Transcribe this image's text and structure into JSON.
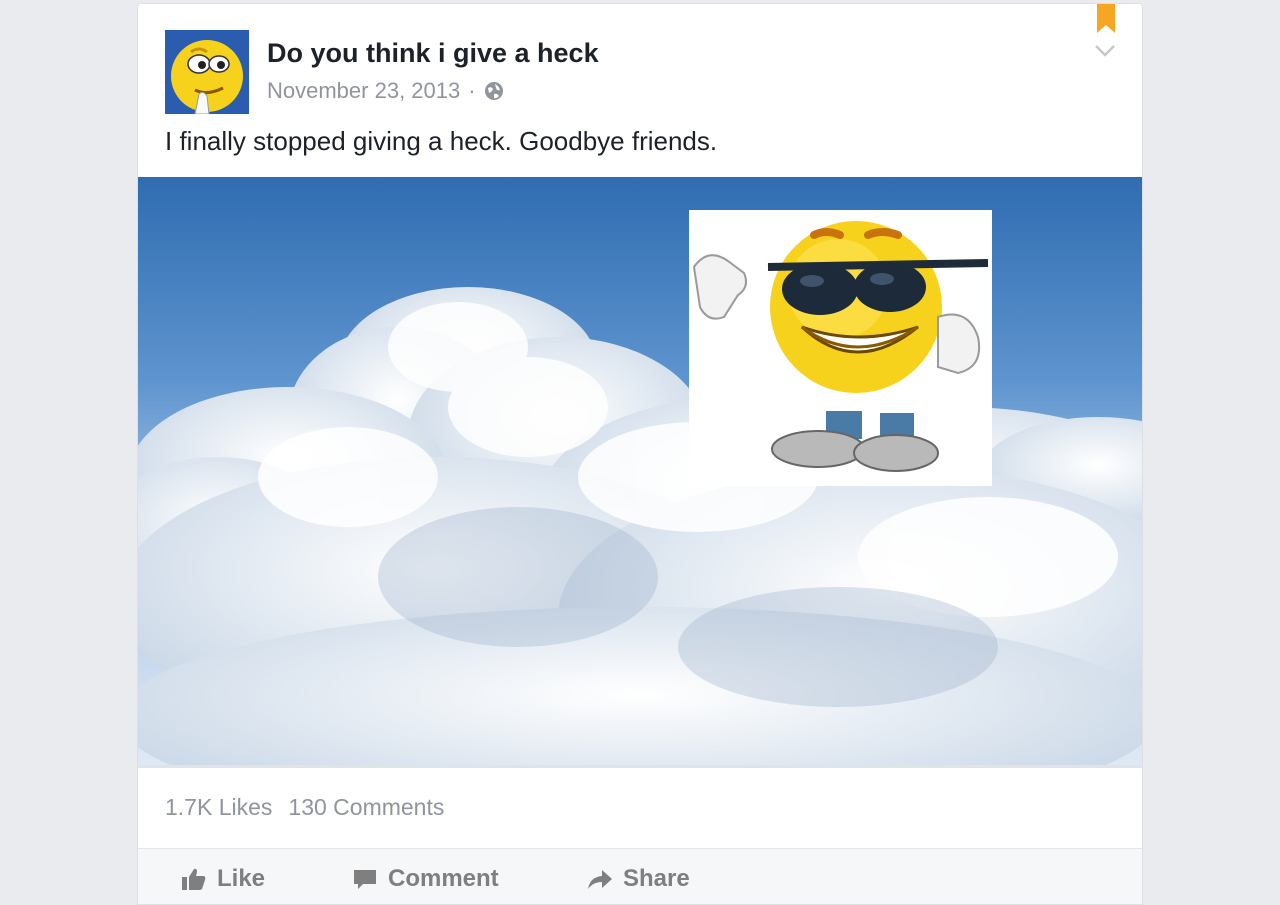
{
  "post": {
    "page_name": "Do you think i give a heck",
    "date": "November 23, 2013",
    "separator": "·",
    "privacy_icon": "globe-icon",
    "text": "I finally stopped giving a heck. Goodbye friends."
  },
  "stats": {
    "likes": "1.7K Likes",
    "comments": "130 Comments"
  },
  "actions": {
    "like": "Like",
    "comment": "Comment",
    "share": "Share"
  },
  "icons": {
    "bookmark": "bookmark-icon",
    "chevron": "chevron-down-icon",
    "like": "thumbs-up-icon",
    "comment": "speech-bubble-icon",
    "share": "share-arrow-icon"
  },
  "colors": {
    "background": "#e9ebee",
    "card": "#ffffff",
    "title": "#1d2129",
    "meta": "#90949c",
    "action": "#7f7f7f",
    "bookmark": "#f5a623",
    "sky_top": "#2f6cb1",
    "emoji_yellow": "#f7d21c"
  }
}
